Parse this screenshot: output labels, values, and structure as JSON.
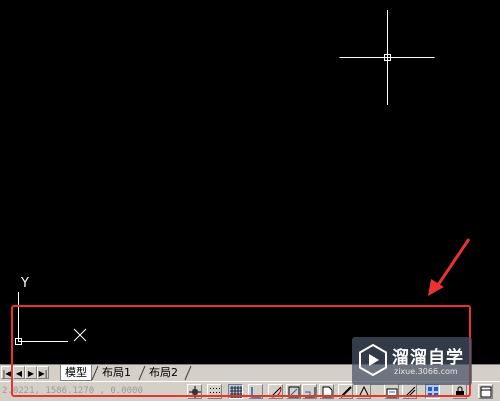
{
  "canvas": {
    "background": "#000000",
    "crosshair_color": "#ffffff",
    "ucs_y_label": "Y",
    "ucs_x_label": "X"
  },
  "annotation": {
    "arrow_color": "#e8332e",
    "highlight_color": "#e8332e"
  },
  "tabs": {
    "nav_buttons": [
      "first-tab",
      "previous-tab",
      "next-tab",
      "last-tab"
    ],
    "items": [
      {
        "label": "模型",
        "active": true
      },
      {
        "label": "布局1",
        "active": false
      },
      {
        "label": "布局2",
        "active": false
      }
    ]
  },
  "status_bar": {
    "coordinates": "2.0221, 1586.1270 , 0.0000",
    "buttons": [
      "snap-icon",
      "grid-icon",
      "ortho-icon",
      "polar-icon",
      "osnap-icon",
      "otrack-icon",
      "ducs-icon",
      "dyn-icon",
      "lineweight-icon",
      "quickprops-icon",
      "model-icon",
      "annotation-icon",
      "workspace-icon",
      "lock-icon",
      "clean-screen-icon"
    ]
  },
  "watermark": {
    "name": "溜溜自学",
    "url": "zixue.3066.com"
  }
}
